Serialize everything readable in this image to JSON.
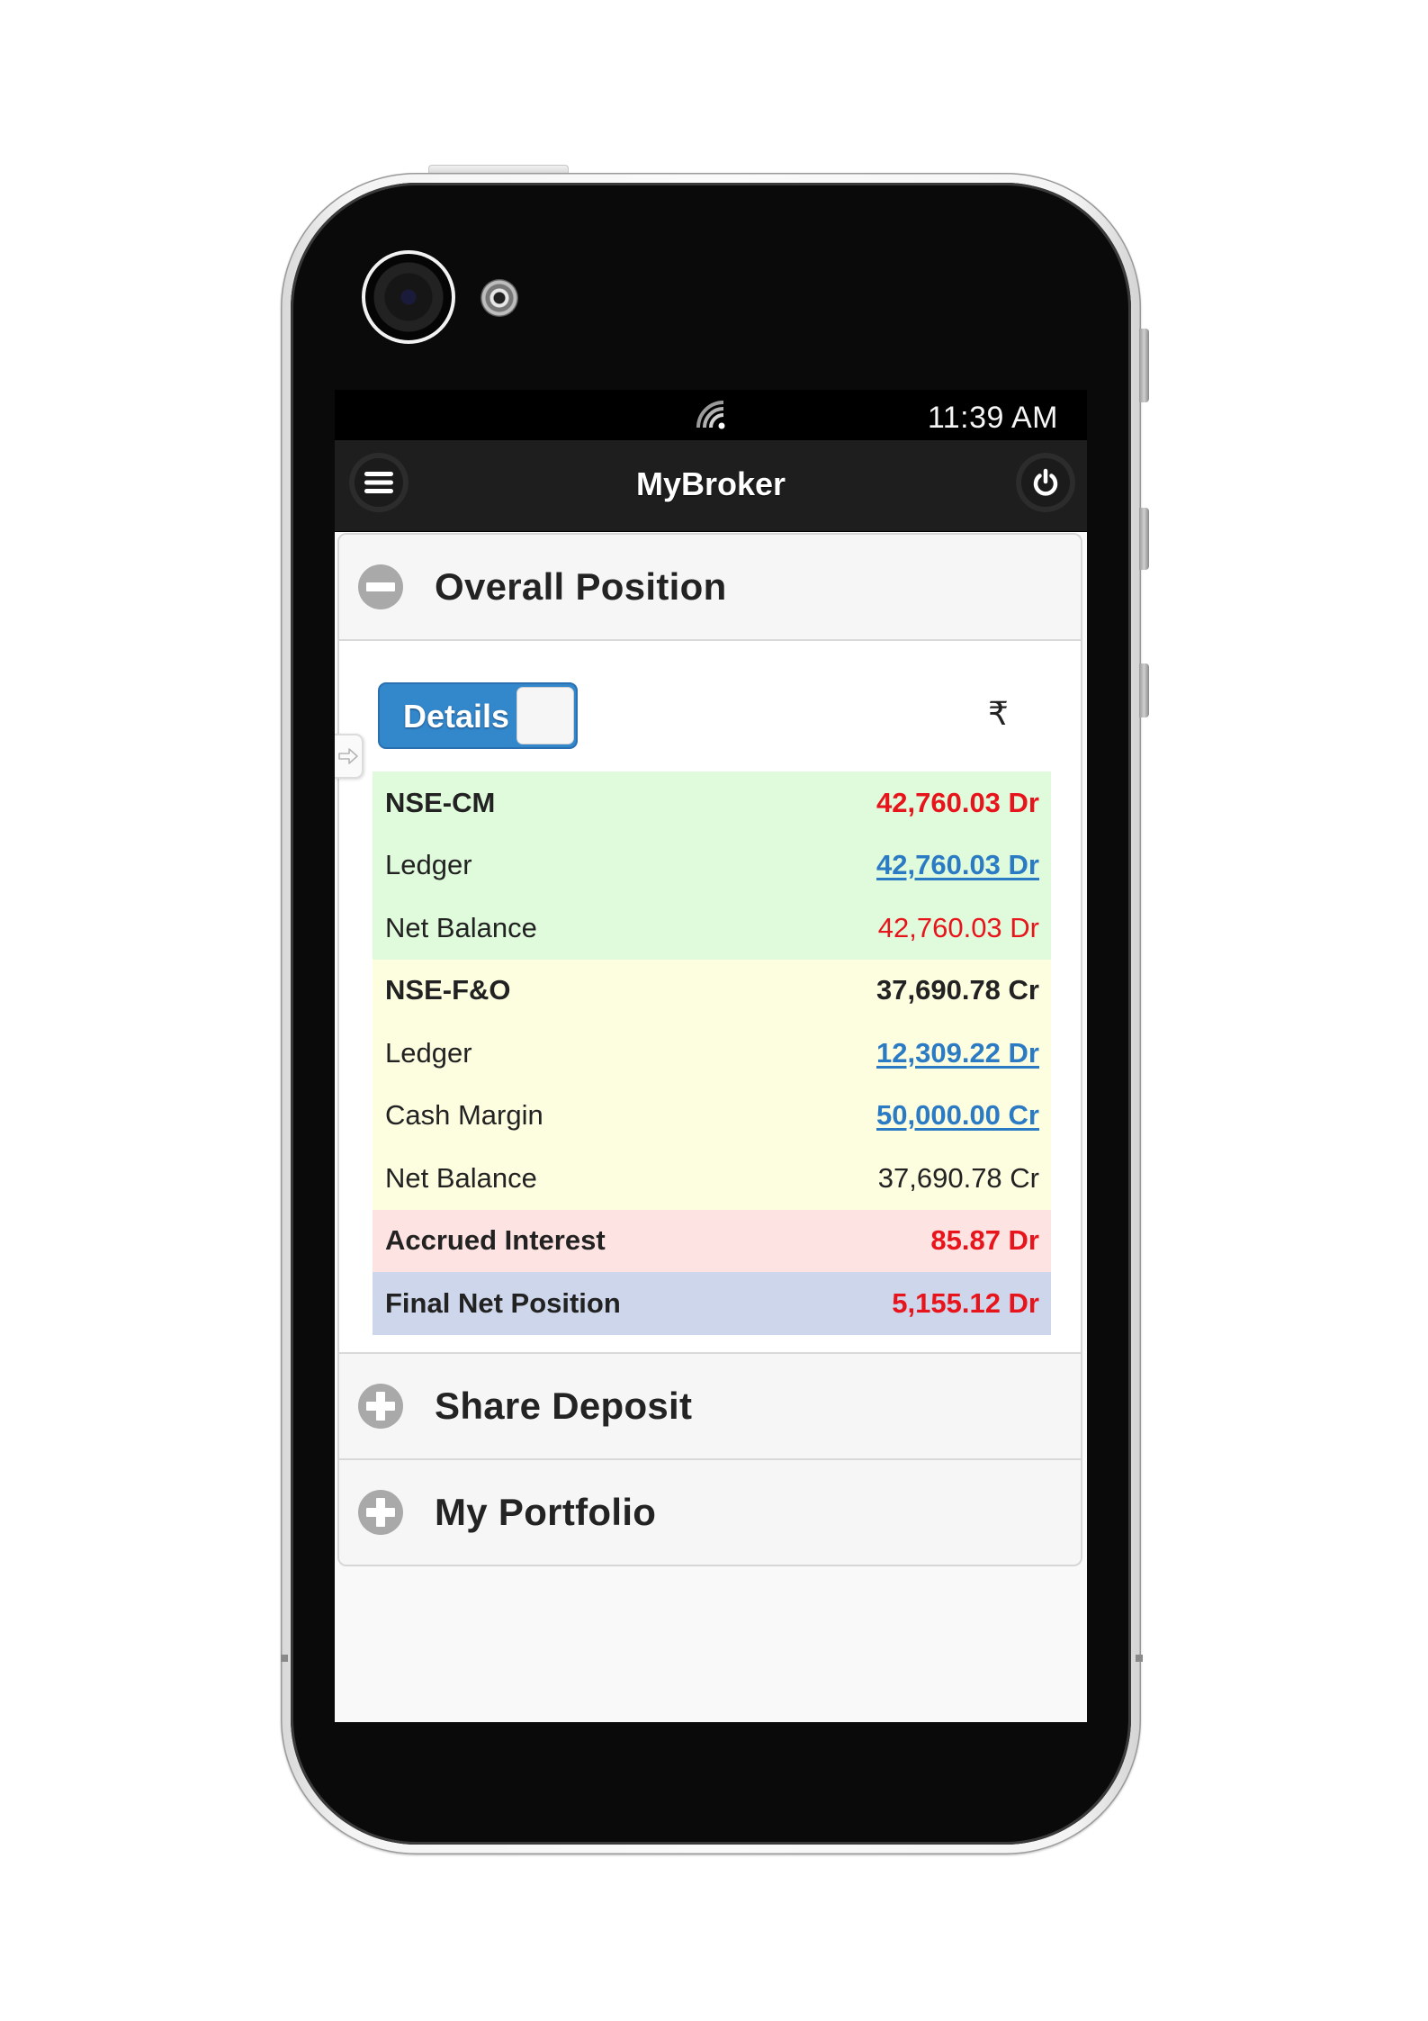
{
  "status_bar": {
    "time": "11:39 AM",
    "signal_icon": "wifi-icon"
  },
  "header": {
    "title": "MyBroker",
    "menu_icon": "hamburger-menu-icon",
    "power_icon": "power-icon"
  },
  "sections": [
    {
      "title": "Overall Position",
      "expanded": true,
      "icon": "minus-circle-icon"
    },
    {
      "title": "Share Deposit",
      "expanded": false,
      "icon": "plus-circle-icon"
    },
    {
      "title": "My Portfolio",
      "expanded": false,
      "icon": "plus-circle-icon"
    }
  ],
  "overall_position": {
    "toggle_label": "Details",
    "toggle_on": true,
    "currency_symbol": "₹",
    "rows": [
      {
        "label": "NSE-CM",
        "value": "42,760.03 Dr",
        "group": "nse-cm",
        "bold": true,
        "style": "red"
      },
      {
        "label": "Ledger",
        "value": "42,760.03 Dr",
        "group": "nse-cm",
        "bold": false,
        "style": "link"
      },
      {
        "label": "Net Balance",
        "value": "42,760.03 Dr",
        "group": "nse-cm",
        "bold": false,
        "style": "red"
      },
      {
        "label": "NSE-F&O",
        "value": "37,690.78 Cr",
        "group": "nse-fo",
        "bold": true,
        "style": "normal"
      },
      {
        "label": "Ledger",
        "value": "12,309.22 Dr",
        "group": "nse-fo",
        "bold": false,
        "style": "link"
      },
      {
        "label": "Cash Margin",
        "value": "50,000.00 Cr",
        "group": "nse-fo",
        "bold": false,
        "style": "link"
      },
      {
        "label": "Net Balance",
        "value": "37,690.78 Cr",
        "group": "nse-fo",
        "bold": false,
        "style": "normal"
      },
      {
        "label": "Accrued Interest",
        "value": "85.87 Dr",
        "group": "interest",
        "bold": true,
        "style": "red"
      },
      {
        "label": "Final Net Position",
        "value": "5,155.12 Dr",
        "group": "final",
        "bold": true,
        "style": "red"
      }
    ]
  },
  "colors": {
    "nse_cm_bg": "#e0fbdc",
    "nse_fo_bg": "#fdfde0",
    "interest_bg": "#fde3e1",
    "final_bg": "#cdd6ea",
    "debit_red": "#e8141c",
    "link_blue": "#2b7bc4",
    "toggle_blue": "#3388cc"
  }
}
